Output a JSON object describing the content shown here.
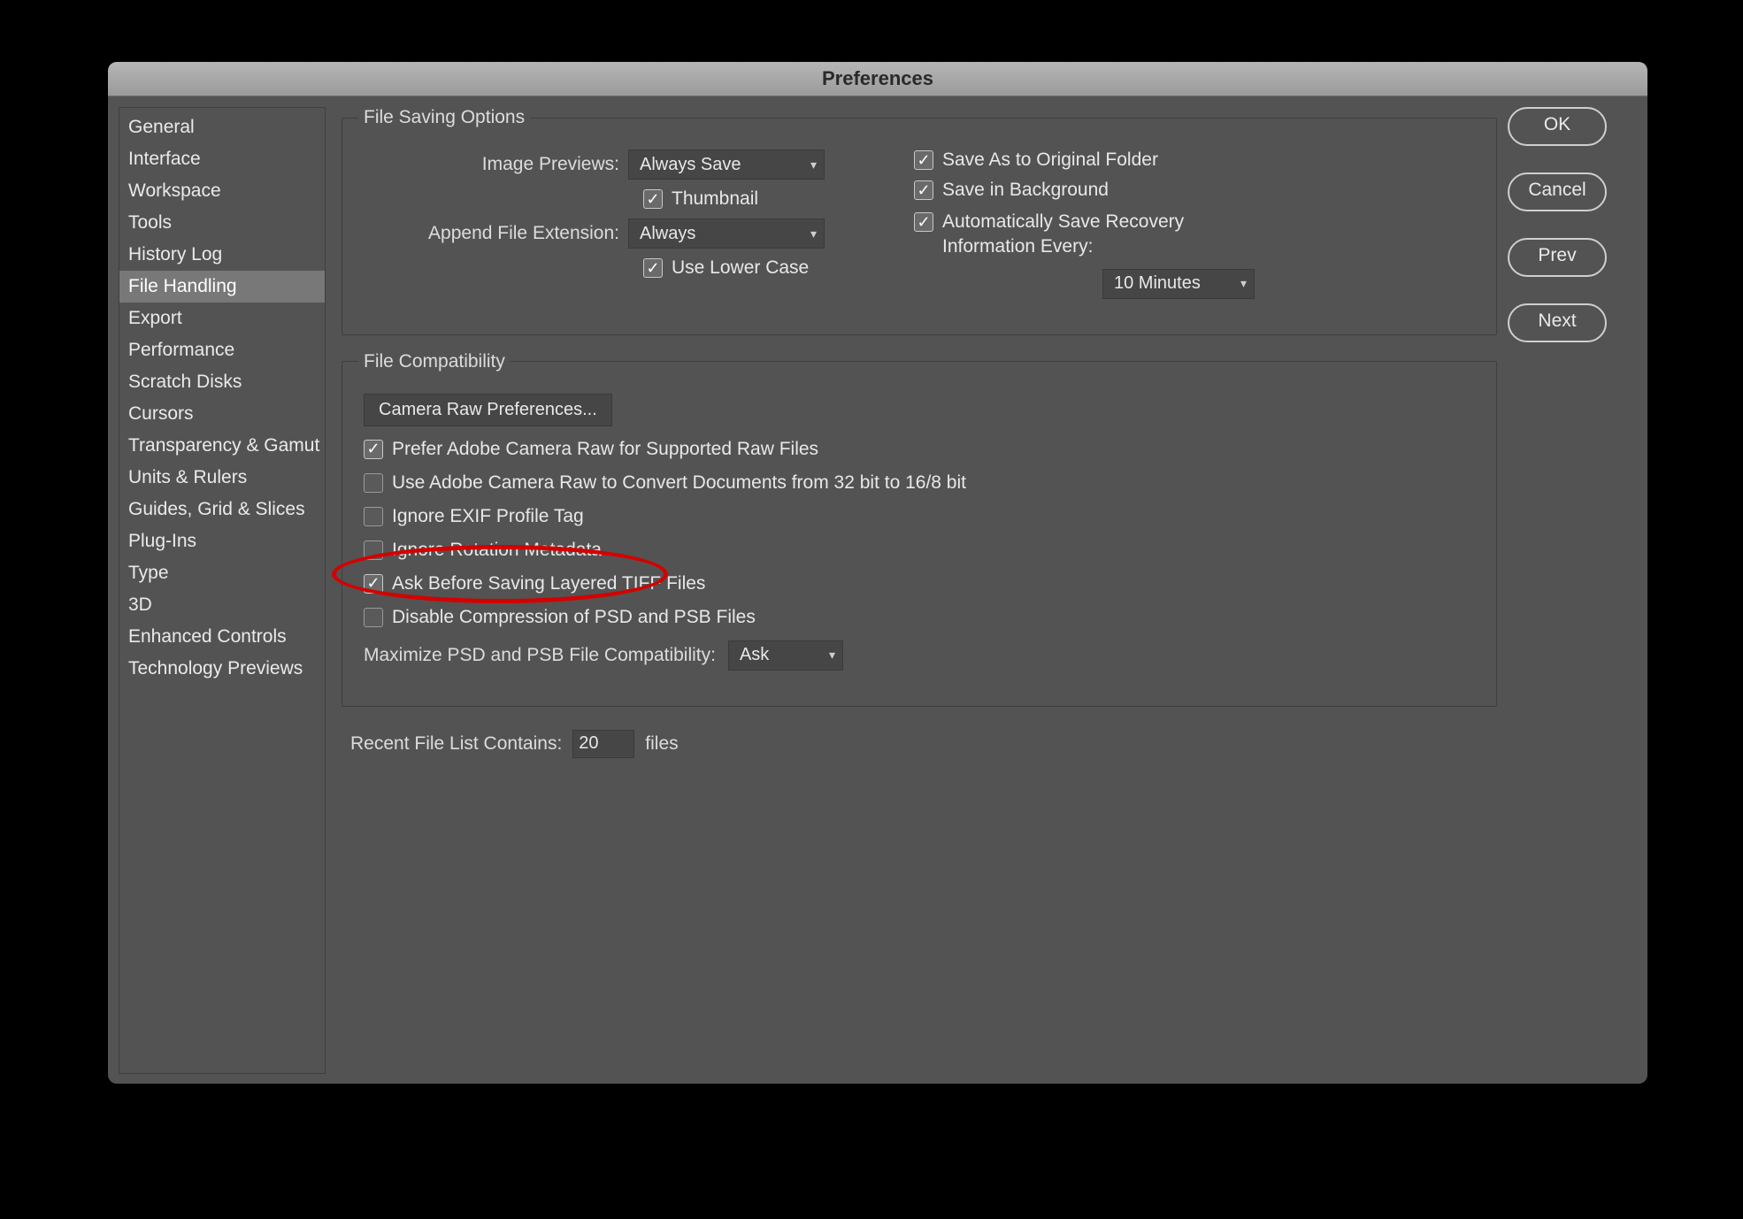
{
  "window": {
    "title": "Preferences"
  },
  "buttons": {
    "ok": "OK",
    "cancel": "Cancel",
    "prev": "Prev",
    "next": "Next"
  },
  "sidebar": {
    "items": [
      "General",
      "Interface",
      "Workspace",
      "Tools",
      "History Log",
      "File Handling",
      "Export",
      "Performance",
      "Scratch Disks",
      "Cursors",
      "Transparency & Gamut",
      "Units & Rulers",
      "Guides, Grid & Slices",
      "Plug-Ins",
      "Type",
      "3D",
      "Enhanced Controls",
      "Technology Previews"
    ],
    "selected_index": 5
  },
  "saving": {
    "legend": "File Saving Options",
    "image_previews_label": "Image Previews:",
    "image_previews_value": "Always Save",
    "thumbnail_label": "Thumbnail",
    "append_ext_label": "Append File Extension:",
    "append_ext_value": "Always",
    "lower_case_label": "Use Lower Case",
    "save_as_orig_label": "Save As to Original Folder",
    "save_bg_label": "Save in Background",
    "auto_save_label_line1": "Automatically Save Recovery",
    "auto_save_label_line2": "Information Every:",
    "auto_save_interval": "10 Minutes"
  },
  "compat": {
    "legend": "File Compatibility",
    "camera_raw_btn": "Camera Raw Preferences...",
    "prefer_acr": "Prefer Adobe Camera Raw for Supported Raw Files",
    "use_acr_convert": "Use Adobe Camera Raw to Convert Documents from 32 bit to 16/8 bit",
    "ignore_exif": "Ignore EXIF Profile Tag",
    "ignore_rotation": "Ignore Rotation Metadata",
    "ask_tiff": "Ask Before Saving Layered TIFF Files",
    "disable_compress": "Disable Compression of PSD and PSB Files",
    "maximize_label": "Maximize PSD and PSB File Compatibility:",
    "maximize_value": "Ask"
  },
  "recent": {
    "label": "Recent File List Contains:",
    "value": "20",
    "suffix": "files"
  }
}
